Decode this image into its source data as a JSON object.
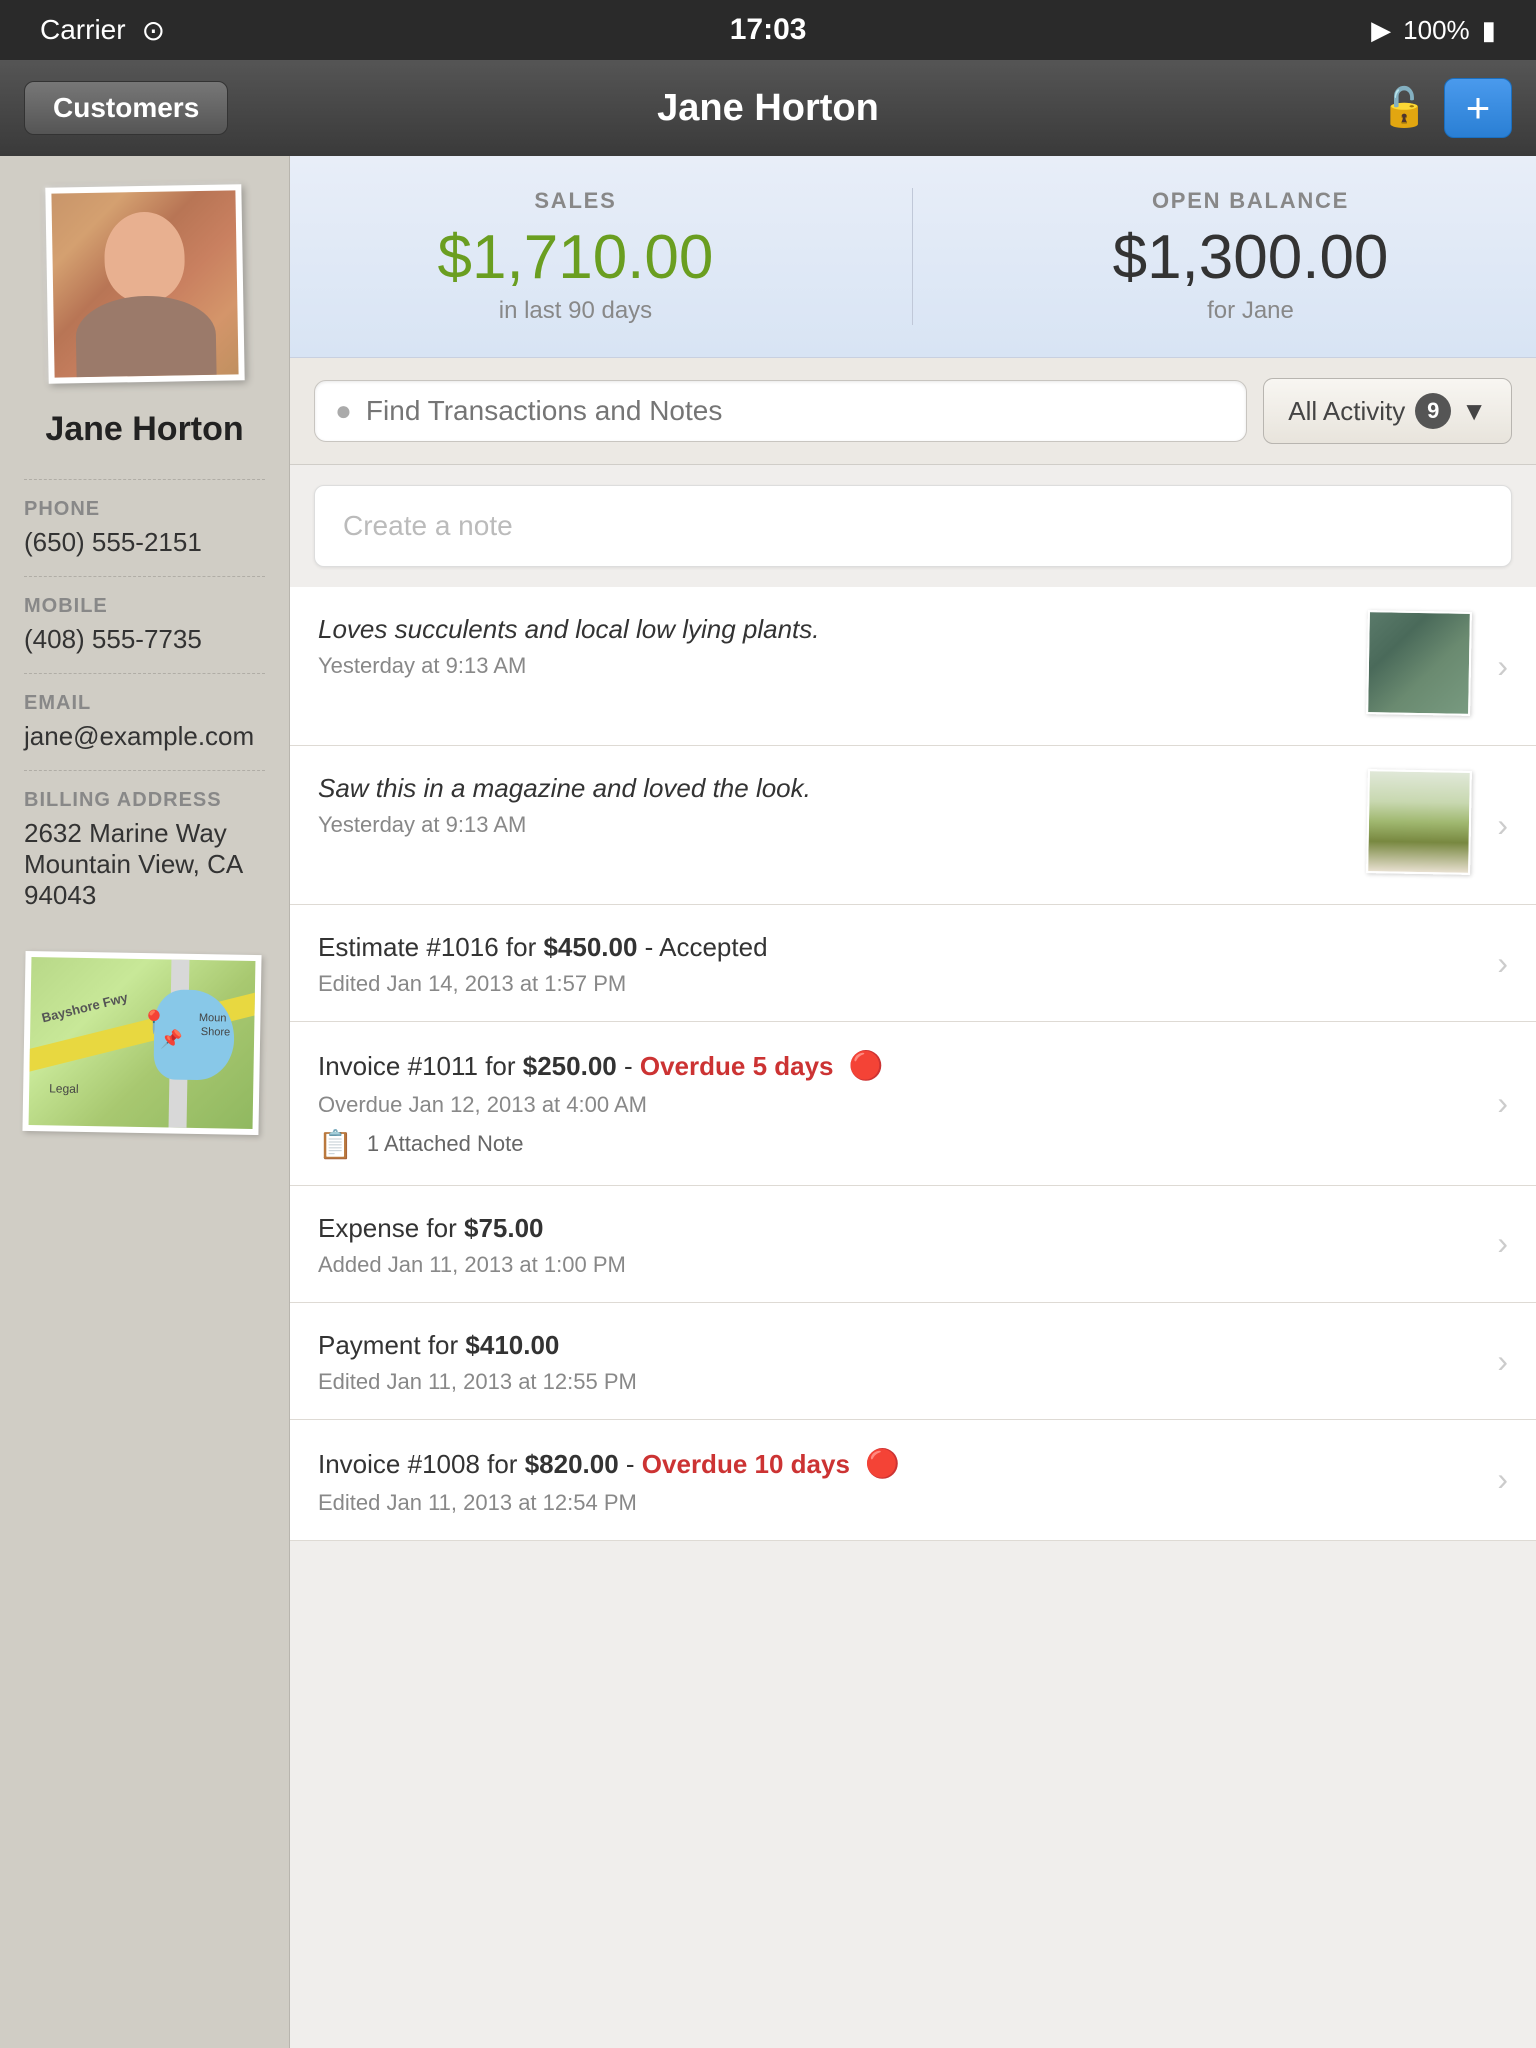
{
  "status_bar": {
    "carrier": "Carrier",
    "time": "17:03",
    "battery": "100%"
  },
  "nav": {
    "back_label": "Customers",
    "title": "Jane Horton",
    "add_label": "+"
  },
  "summary": {
    "sales_label": "SALES",
    "sales_amount": "$1,710.00",
    "sales_sub": "in last 90 days",
    "balance_label": "OPEN BALANCE",
    "balance_amount": "$1,300.00",
    "balance_sub": "for Jane"
  },
  "search": {
    "placeholder": "Find Transactions and Notes",
    "filter_label": "All Activity",
    "filter_count": "9"
  },
  "note_input": {
    "placeholder": "Create a note"
  },
  "customer": {
    "name": "Jane Horton",
    "phone_label": "PHONE",
    "phone": "(650) 555-2151",
    "mobile_label": "MOBILE",
    "mobile": "(408) 555-7735",
    "email_label": "EMAIL",
    "email": "jane@example.com",
    "billing_label": "BILLING ADDRESS",
    "address1": "2632 Marine Way",
    "address2": "Mountain View, CA 94043"
  },
  "activity": [
    {
      "type": "note",
      "title": "Loves succulents and local low lying plants.",
      "subtitle": "Yesterday at 9:13 AM",
      "has_thumb": true,
      "thumb_type": "succulent"
    },
    {
      "type": "note",
      "title": "Saw this in a magazine and loved the look.",
      "subtitle": "Yesterday at 9:13 AM",
      "has_thumb": true,
      "thumb_type": "garden"
    },
    {
      "type": "estimate",
      "title_prefix": "Estimate #1016 for ",
      "amount": "$450.00",
      "status": "Accepted",
      "subtitle": "Edited Jan 14, 2013 at 1:57 PM",
      "overdue": false
    },
    {
      "type": "invoice",
      "title_prefix": "Invoice #1011 for ",
      "amount": "$250.00",
      "status": "Overdue 5 days",
      "subtitle": "Overdue Jan 12, 2013 at 4:00 AM",
      "overdue": true,
      "attached_note": "1 Attached Note"
    },
    {
      "type": "expense",
      "title_prefix": "Expense for ",
      "amount": "$75.00",
      "subtitle": "Added Jan 11, 2013 at 1:00 PM",
      "overdue": false
    },
    {
      "type": "payment",
      "title_prefix": "Payment for ",
      "amount": "$410.00",
      "subtitle": "Edited Jan 11, 2013 at 12:55 PM",
      "overdue": false
    },
    {
      "type": "invoice",
      "title_prefix": "Invoice #1008 for ",
      "amount": "$820.00",
      "status": "Overdue 10 days",
      "subtitle": "Edited Jan 11, 2013 at 12:54 PM",
      "overdue": true
    }
  ]
}
